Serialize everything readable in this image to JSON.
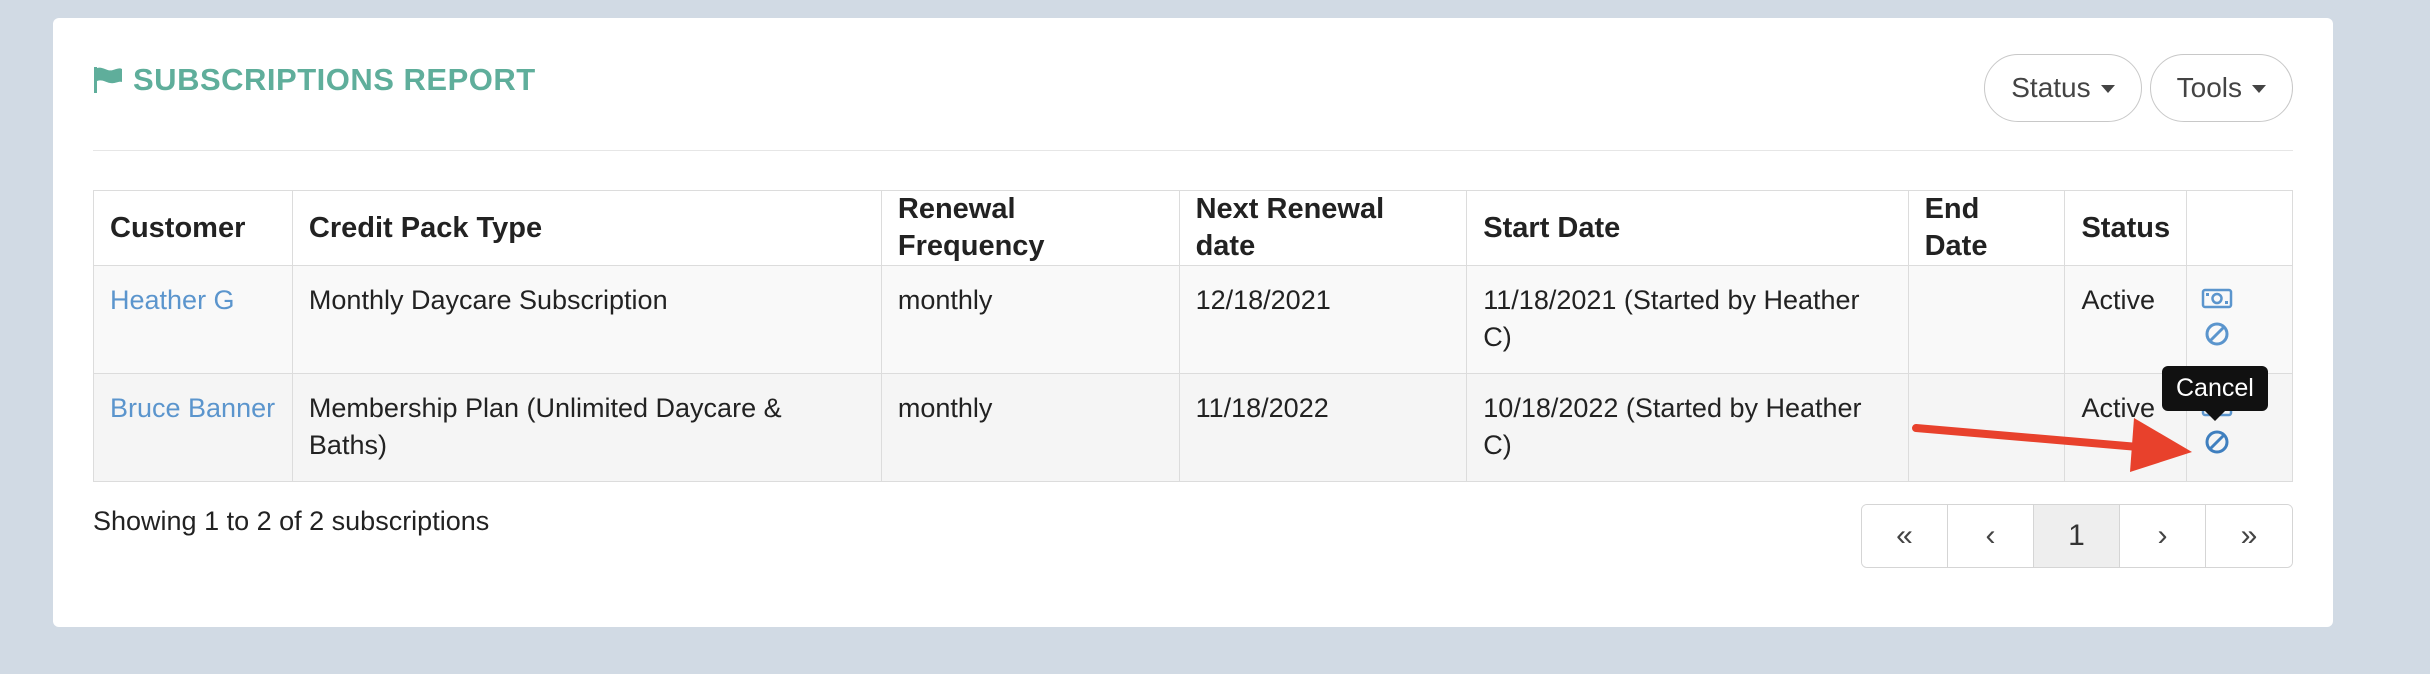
{
  "report": {
    "title": "SUBSCRIPTIONS REPORT",
    "status_button": "Status",
    "tools_button": "Tools"
  },
  "table": {
    "headers": [
      "Customer",
      "Credit Pack Type",
      "Renewal Frequency",
      "Next Renewal date",
      "Start Date",
      "End Date",
      "Status",
      ""
    ],
    "rows": [
      {
        "customer": "Heather G",
        "credit_pack_type": "Monthly Daycare Subscription",
        "renewal_frequency": "monthly",
        "next_renewal_date": "12/18/2021",
        "start_date": "11/18/2021 (Started by Heather C)",
        "end_date": "",
        "status": "Active"
      },
      {
        "customer": "Bruce Banner",
        "credit_pack_type": "Membership Plan (Unlimited Daycare & Baths)",
        "renewal_frequency": "monthly",
        "next_renewal_date": "11/18/2022",
        "start_date": "10/18/2022 (Started by Heather C)",
        "end_date": "",
        "status": "Active"
      }
    ]
  },
  "footer": {
    "showing_text": "Showing 1 to 2 of 2 subscriptions"
  },
  "pagination": {
    "first": "«",
    "prev": "‹",
    "current": "1",
    "next": "›",
    "last": "»"
  },
  "tooltip": {
    "text": "Cancel"
  },
  "icons": {
    "title_icon": "flag-icon",
    "row_action_1": "money-icon",
    "row_action_2": "cancel-icon"
  },
  "colors": {
    "title": "#5fae9b",
    "link": "#5b95cd",
    "icon": "#5b95cd",
    "annotation_arrow": "#e8412c"
  }
}
